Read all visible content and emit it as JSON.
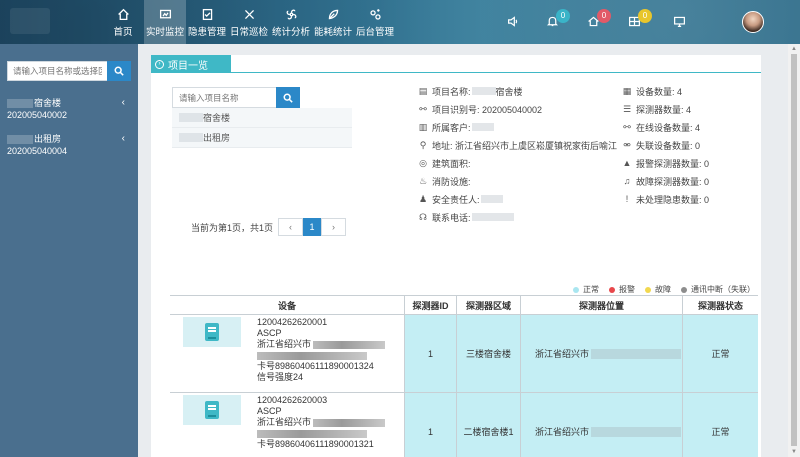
{
  "nav": {
    "items": [
      {
        "label": "首页",
        "icon": "home-icon"
      },
      {
        "label": "实时监控",
        "icon": "monitor-icon",
        "active": true
      },
      {
        "label": "隐患管理",
        "icon": "checklist-icon"
      },
      {
        "label": "日常巡检",
        "icon": "tools-icon"
      },
      {
        "label": "统计分析",
        "icon": "fan-icon"
      },
      {
        "label": "能耗统计",
        "icon": "energy-icon"
      },
      {
        "label": "后台管理",
        "icon": "settings-icon"
      }
    ],
    "right": {
      "bell_count": "0",
      "home_count": "0",
      "alarm_count": "0"
    }
  },
  "sidebar": {
    "search_placeholder": "请输入项目名称或选择区",
    "items": [
      {
        "name_suffix": "宿舍楼",
        "code": "202005040002"
      },
      {
        "name_suffix": "出租房",
        "code": "202005040004"
      }
    ]
  },
  "main": {
    "tab_title": "项目一览",
    "project_search_placeholder": "请输入项目名称",
    "project_list": [
      {
        "name_suffix": "宿舍楼"
      },
      {
        "name_suffix": "出租房"
      }
    ],
    "pager": {
      "summary": "当前为第1页，共1页",
      "prev": "‹",
      "current": "1",
      "next": "›"
    },
    "info": {
      "name_label": "项目名称:",
      "name_suffix": "宿舍楼",
      "code_label": "项目识别号: 202005040002",
      "owner_label": "所属客户:",
      "address_label": "地址: 浙江省绍兴市上虞区崧厦镇祝家街后喻江",
      "area_label": "建筑面积:",
      "fire_label": "消防设施:",
      "person_label": "安全责任人:",
      "phone_label": "联系电话:"
    },
    "stats": {
      "devices": "设备数量: 4",
      "detectors": "探测器数量: 4",
      "online": "在线设备数量: 4",
      "offline": "失联设备数量: 0",
      "alarm_detectors": "报警探测器数量: 0",
      "fault_detectors": "故障探测器数量: 0",
      "hazards": "未处理隐患数量: 0"
    },
    "legend": [
      {
        "label": "正常",
        "color": "#a9e6f0"
      },
      {
        "label": "报警",
        "color": "#e8474b"
      },
      {
        "label": "故障",
        "color": "#f2d84f"
      },
      {
        "label": "通讯中断（失联）",
        "color": "#8d8d8d"
      }
    ],
    "table": {
      "headers": [
        "设备",
        "探测器ID",
        "探测器区域",
        "探测器位置",
        "探测器状态"
      ],
      "rows": [
        {
          "serial": "12004262620001",
          "model": "ASCP",
          "addr": "浙江省绍兴市",
          "card": "卡号89860406111890001324",
          "signal": "信号强度24",
          "detector_id": "1",
          "area": "三楼宿舍楼",
          "location": "浙江省绍兴市",
          "status": "正常"
        },
        {
          "serial": "12004262620003",
          "model": "ASCP",
          "addr": "浙江省绍兴市",
          "card": "卡号89860406111890001321",
          "signal": "",
          "detector_id": "1",
          "area": "二楼宿舍楼1",
          "location": "浙江省绍兴市",
          "status": "正常"
        }
      ]
    }
  }
}
